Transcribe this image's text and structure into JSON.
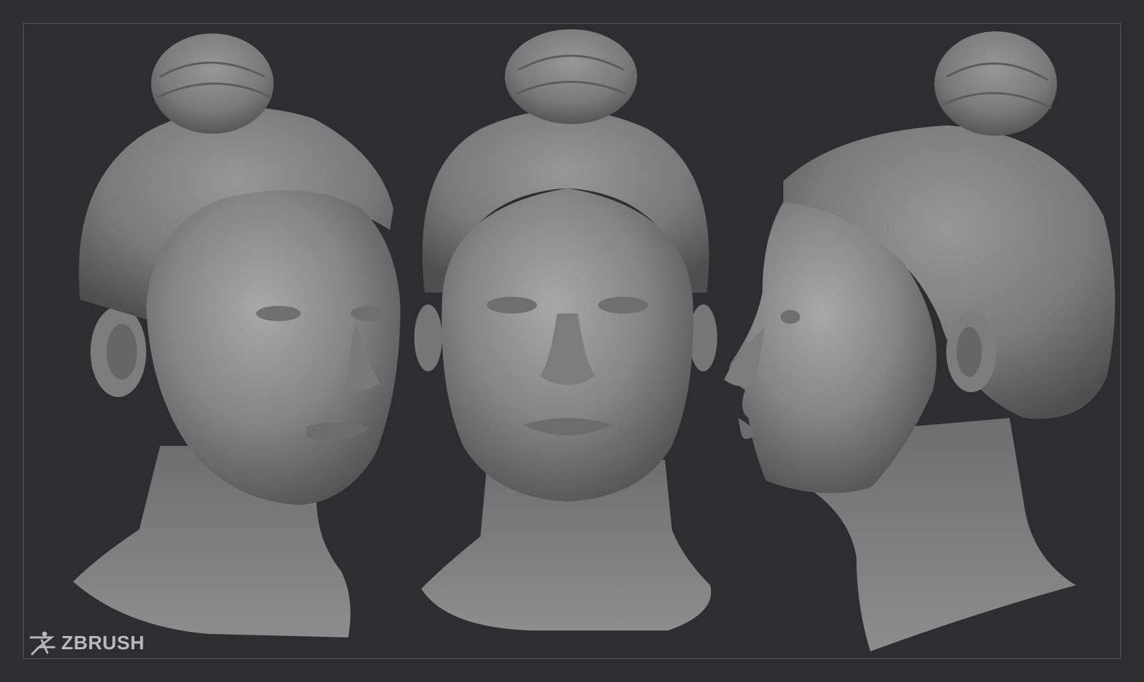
{
  "logo": {
    "text": "ZBRUSH",
    "icon": "zbrush-figure-icon"
  },
  "colors": {
    "background": "#2e2e30",
    "frame_border": "#5a5a5c",
    "clay": "#8a8a8a",
    "logo_text": "#b9b9b9"
  },
  "views": [
    "three-quarter",
    "front",
    "profile"
  ]
}
